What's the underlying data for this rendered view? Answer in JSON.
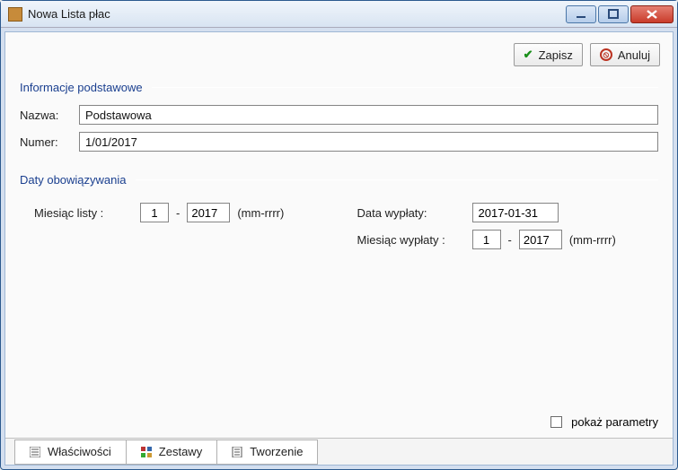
{
  "window": {
    "title": "Nowa Lista płac"
  },
  "actions": {
    "save": "Zapisz",
    "cancel": "Anuluj"
  },
  "basic": {
    "legend": "Informacje podstawowe",
    "name_label": "Nazwa:",
    "name_value": "Podstawowa",
    "number_label": "Numer:",
    "number_value": "1/01/2017"
  },
  "dates": {
    "legend": "Daty obowiązywania",
    "list_month_label": "Miesiąc listy :",
    "list_month_mm": "1",
    "list_month_yyyy": "2017",
    "format_hint": "(mm-rrrr)",
    "payout_date_label": "Data wypłaty:",
    "payout_date_value": "2017-01-31",
    "payout_month_label": "Miesiąc wypłaty :",
    "payout_month_mm": "1",
    "payout_month_yyyy": "2017"
  },
  "footer": {
    "show_params_label": "pokaż parametry",
    "show_params_checked": false
  },
  "tabs": {
    "properties": "Właściwości",
    "sets": "Zestawy",
    "creation": "Tworzenie"
  }
}
